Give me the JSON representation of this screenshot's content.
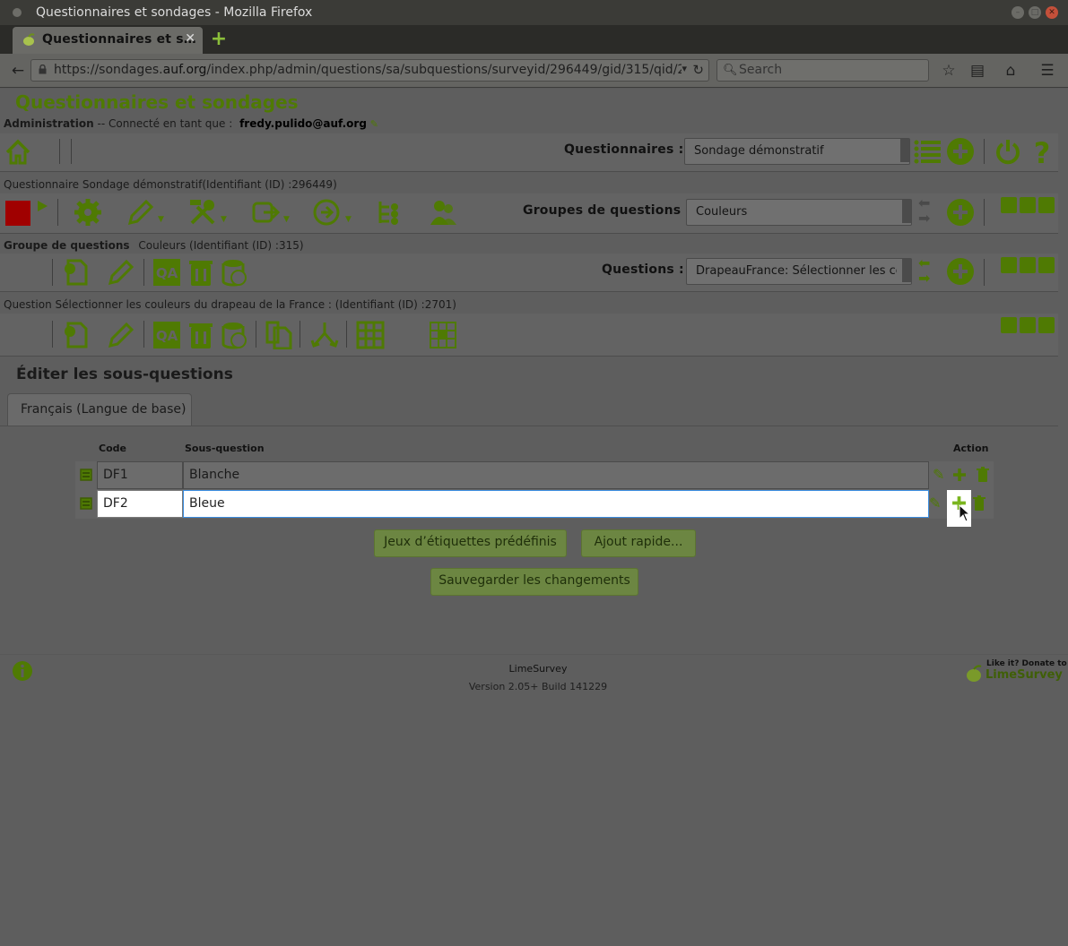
{
  "window": {
    "title": "Questionnaires et sondages - Mozilla Firefox"
  },
  "tabs": [
    {
      "label": "Questionnaires et s…"
    }
  ],
  "url": {
    "prefix": "https://sondages.",
    "domain": "auf.org",
    "path": "/index.php/admin/questions/sa/subquestions/surveyid/296449/gid/315/qid/2"
  },
  "search": {
    "placeholder": "Search"
  },
  "app": {
    "title": "Questionnaires et sondages",
    "admin_prefix": "Administration",
    "connected_text": " -- Connecté en tant que :",
    "user": "fredy.pulido@auf.org"
  },
  "toolbar_main": {
    "label": "Questionnaires :",
    "selected": "Sondage démonstratif"
  },
  "survey": {
    "prefix": "Questionnaire",
    "text": "Sondage démonstratif(Identifiant (ID) :296449)",
    "groups_label": "Groupes de questions :",
    "groups_selected": "Couleurs"
  },
  "group": {
    "prefix": "Groupe de questions",
    "text": "Couleurs (Identifiant (ID) :315)",
    "questions_label": "Questions :",
    "questions_selected": "DrapeauFrance: Sélectionner les coule"
  },
  "question": {
    "prefix": "Question",
    "text": "Sélectionner les couleurs du drapeau de la France : (Identifiant (ID) :2701)"
  },
  "edit": {
    "heading": "Éditer les sous-questions",
    "lang_tab": "Français (Langue de base)",
    "col_code": "Code",
    "col_subquestion": "Sous-question",
    "col_action": "Action",
    "rows": [
      {
        "code": "DF1",
        "text": "Blanche"
      },
      {
        "code": "DF2",
        "text": "Bleue"
      }
    ],
    "btn_predefined": "Jeux d’étiquettes prédéfinis",
    "btn_quick_add": "Ajout rapide...",
    "btn_save": "Sauvegarder les changements"
  },
  "footer": {
    "app_name": "LimeSurvey",
    "version": "Version 2.05+ Build 141229",
    "donate_line1": "Like it? Donate to",
    "donate_line2": "LimeSurvey"
  },
  "colors": {
    "accent": "#4f7a03",
    "page_overlay": "#5e5e5e"
  }
}
